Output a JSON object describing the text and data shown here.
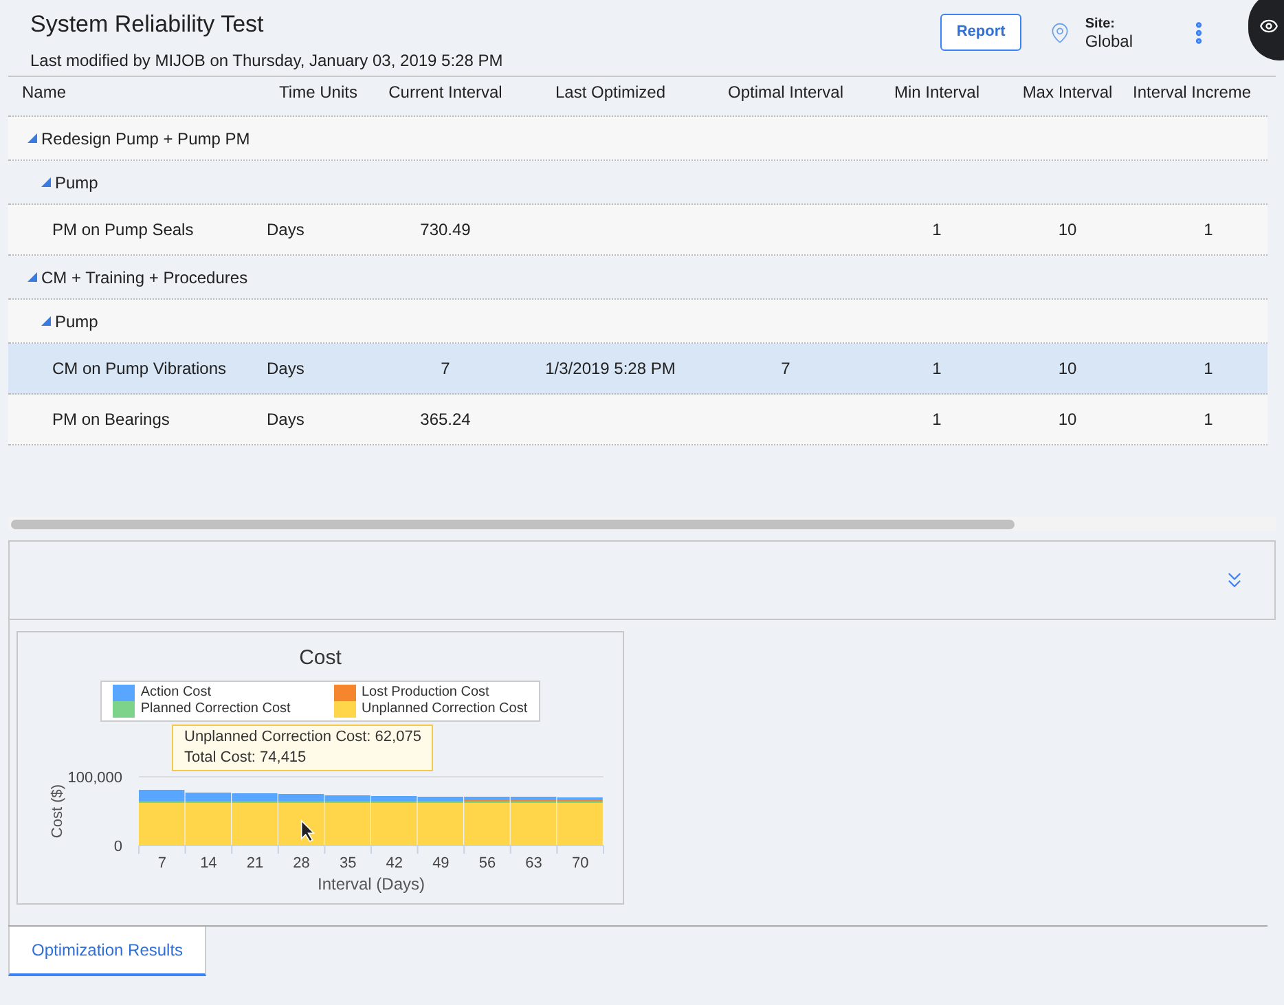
{
  "header": {
    "title": "System Reliability Test",
    "subtitle": "Last modified by MIJOB on Thursday, January 03, 2019 5:28 PM",
    "report_button": "Report",
    "site_label": "Site:",
    "site_value": "Global"
  },
  "table": {
    "columns": [
      "Name",
      "Time Units",
      "Current Interval",
      "Last Optimized",
      "Optimal Interval",
      "Min Interval",
      "Max Interval",
      "Interval Increme"
    ],
    "rows": [
      {
        "name": "Redesign Pump + Pump PM",
        "expanded": true,
        "children": [
          {
            "name": "Pump",
            "expanded": true,
            "children": [
              {
                "name": "PM on Pump Seals",
                "selected": false,
                "cells": [
                  "Days",
                  "730.49",
                  "",
                  "",
                  "1",
                  "10",
                  "1"
                ]
              }
            ]
          }
        ]
      },
      {
        "name": "CM + Training + Procedures",
        "expanded": true,
        "children": [
          {
            "name": "Pump",
            "expanded": true,
            "children": [
              {
                "name": "CM on Pump Vibrations",
                "selected": true,
                "cells": [
                  "Days",
                  "7",
                  "1/3/2019 5:28 PM",
                  "7",
                  "1",
                  "10",
                  "1"
                ]
              },
              {
                "name": "PM on Bearings",
                "selected": false,
                "cells": [
                  "Days",
                  "365.24",
                  "",
                  "",
                  "1",
                  "10",
                  "1"
                ]
              }
            ]
          }
        ]
      }
    ]
  },
  "chart_panel": {
    "expanded": false,
    "tooltip": {
      "category": "28",
      "lines": [
        "Unplanned Correction Cost: 62,075",
        "Total Cost: 74,415"
      ]
    },
    "chart_data": {
      "type": "bar",
      "title": "Cost",
      "xlabel": "Interval (Days)",
      "ylabel": "Cost ($)",
      "stacked": true,
      "categories": [
        "7",
        "14",
        "21",
        "28",
        "35",
        "42",
        "49",
        "56",
        "63",
        "70"
      ],
      "yticks": [
        {
          "value": 0,
          "label": "0"
        },
        {
          "value": 100000,
          "label": "100,000"
        }
      ],
      "ylim": [
        0,
        100000
      ],
      "series": [
        {
          "name": "Unplanned Correction Cost",
          "color": "#ffd54a",
          "values": [
            62000,
            62000,
            62000,
            62000,
            62000,
            62000,
            62000,
            62000,
            62000,
            62000
          ]
        },
        {
          "name": "Planned Correction Cost",
          "color": "#7ed38a",
          "values": [
            2000,
            2000,
            2000,
            2000,
            2000,
            2000,
            2000,
            2000,
            2000,
            2000
          ]
        },
        {
          "name": "Lost Production Cost",
          "color": "#f5862e",
          "values": [
            1000,
            1000,
            1000,
            1000,
            1000,
            1000,
            1000,
            2000,
            2000,
            2000
          ]
        },
        {
          "name": "Action Cost",
          "color": "#58a6ff",
          "values": [
            16000,
            12000,
            11000,
            10000,
            8000,
            7000,
            6000,
            5000,
            5000,
            4000
          ]
        }
      ]
    }
  },
  "bottom_tabs": [
    {
      "label": "Optimization Results",
      "selected": true
    }
  ]
}
